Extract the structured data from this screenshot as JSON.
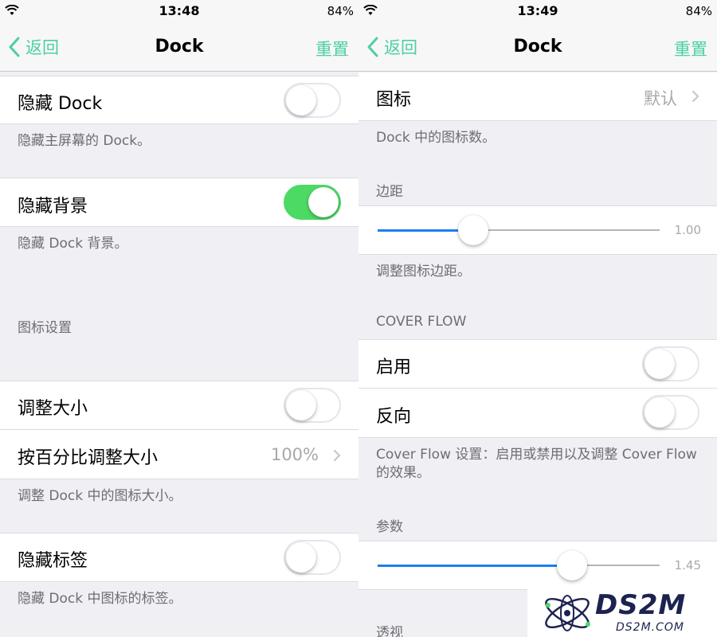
{
  "left": {
    "status": {
      "time": "13:48",
      "battery": "84%"
    },
    "nav": {
      "back": "返回",
      "title": "Dock",
      "action": "重置"
    },
    "hide_dock": {
      "label": "隐藏 Dock",
      "on": false,
      "footnote": "隐藏主屏幕的 Dock。"
    },
    "hide_background": {
      "label": "隐藏背景",
      "on": true,
      "footnote": "隐藏 Dock 背景。"
    },
    "icon_settings_header": "图标设置",
    "resize": {
      "label": "调整大小",
      "on": false
    },
    "resize_percent": {
      "label": "按百分比调整大小",
      "value": "100%"
    },
    "resize_footnote": "调整 Dock 中的图标大小。",
    "hide_labels": {
      "label": "隐藏标签",
      "on": false,
      "footnote": "隐藏 Dock 中图标的标签。"
    }
  },
  "right": {
    "status": {
      "time": "13:49",
      "battery": "84%"
    },
    "nav": {
      "back": "返回",
      "title": "Dock",
      "action": "重置"
    },
    "icons": {
      "label": "图标",
      "value": "默认",
      "footnote": "Dock 中的图标数。"
    },
    "margin": {
      "header": "边距",
      "value": "1.00",
      "fraction": 0.34,
      "footnote": "调整图标边距。"
    },
    "cover_flow_header": "COVER FLOW",
    "enable": {
      "label": "启用",
      "on": false
    },
    "reverse": {
      "label": "反向",
      "on": false
    },
    "cover_flow_footnote": "Cover Flow 设置：启用或禁用以及调整 Cover Flow 的效果。",
    "params": {
      "header": "参数",
      "value": "1.45",
      "fraction": 0.69
    },
    "perspective_header": "透视"
  },
  "watermark": {
    "title": "DS2M",
    "subtitle": "DS2M.COM"
  },
  "colors": {
    "accent": "#4cd0a0",
    "switch_on": "#4cd964",
    "slider": "#1a7ff3"
  },
  "icons": {
    "wifi": "wifi-icon",
    "back": "chevron-left-icon",
    "disclosure": "chevron-right-icon"
  }
}
